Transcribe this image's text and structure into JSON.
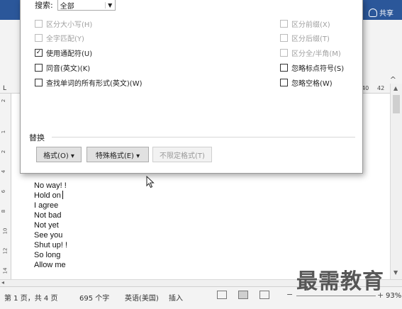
{
  "ribbon": {
    "share_label": "共享"
  },
  "ruler": {
    "corner_mark": "L",
    "marks": [
      "40",
      "42"
    ]
  },
  "vertical_ruler": {
    "marks": [
      "2",
      "1",
      "2",
      "4",
      "6",
      "8",
      "10",
      "12",
      "14"
    ]
  },
  "dialog": {
    "search_label": "搜索:",
    "search_value": "全部",
    "options_left": [
      {
        "label": "区分大小写(H)",
        "checked": false,
        "enabled": false
      },
      {
        "label": "全字匹配(Y)",
        "checked": false,
        "enabled": false
      },
      {
        "label": "使用通配符(U)",
        "checked": true,
        "enabled": true
      },
      {
        "label": "同音(英文)(K)",
        "checked": false,
        "enabled": true
      },
      {
        "label": "查找单词的所有形式(英文)(W)",
        "checked": false,
        "enabled": true
      }
    ],
    "options_right": [
      {
        "label": "区分前缀(X)",
        "checked": false,
        "enabled": false
      },
      {
        "label": "区分后缀(T)",
        "checked": false,
        "enabled": false
      },
      {
        "label": "区分全/半角(M)",
        "checked": false,
        "enabled": false
      },
      {
        "label": "忽略标点符号(S)",
        "checked": false,
        "enabled": true
      },
      {
        "label": "忽略空格(W)",
        "checked": false,
        "enabled": true
      }
    ],
    "replace_section_label": "替换",
    "format_button": "格式(O) ▾",
    "special_button": "特殊格式(E) ▾",
    "no_format_button": "不限定格式(T)"
  },
  "document": {
    "lines": [
      "No way! !",
      "Hold on",
      "I agree",
      "Not bad",
      "Not yet",
      "See you",
      "Shut up! !",
      "So long",
      "Allow me"
    ]
  },
  "status_bar": {
    "page_info": "第 1 页，共 4 页",
    "word_count": "695 个字",
    "language": "英语(美国)",
    "mode": "插入",
    "zoom": "93%"
  },
  "watermark": "最需教育"
}
